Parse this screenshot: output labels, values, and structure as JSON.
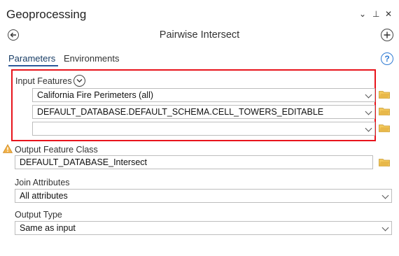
{
  "pane": {
    "title": "Geoprocessing",
    "controls": [
      "⌄",
      "⊥",
      "✕"
    ]
  },
  "tool": {
    "name": "Pairwise Intersect"
  },
  "tabs": [
    {
      "label": "Parameters",
      "active": true
    },
    {
      "label": "Environments",
      "active": false
    }
  ],
  "input_features": {
    "label": "Input Features",
    "rows": [
      {
        "value": "California Fire Perimeters (all)"
      },
      {
        "value": "DEFAULT_DATABASE.DEFAULT_SCHEMA.CELL_TOWERS_EDITABLE"
      },
      {
        "value": ""
      }
    ]
  },
  "output_feature_class": {
    "label": "Output Feature Class",
    "value": "DEFAULT_DATABASE_Intersect"
  },
  "join_attributes": {
    "label": "Join Attributes",
    "value": "All attributes"
  },
  "output_type": {
    "label": "Output Type",
    "value": "Same as input"
  },
  "icons": {
    "back": "back-arrow-icon",
    "add": "add-icon",
    "help": "help-icon",
    "expand": "chevron-down-circle-icon",
    "browse": "folder-icon",
    "warning": "warning-icon"
  },
  "colors": {
    "highlight": "#e8141c",
    "accent": "#2b579a",
    "help": "#2f7bd3",
    "folder": "#e8b84a",
    "warning": "#e8a33c"
  }
}
